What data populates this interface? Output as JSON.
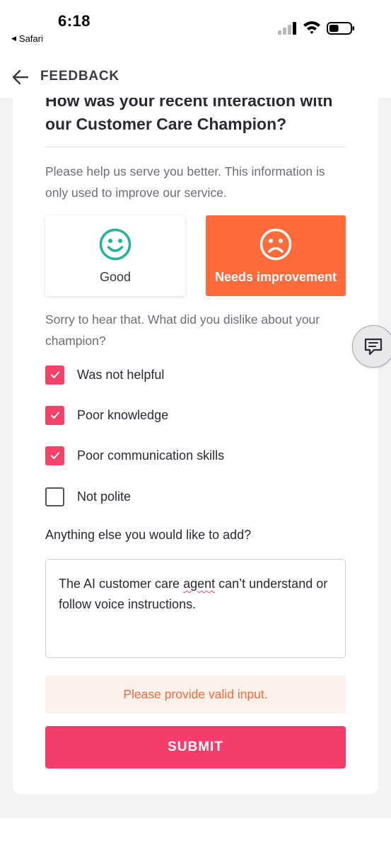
{
  "status_bar": {
    "time": "6:18",
    "back_app": "Safari",
    "battery_level": 0.45
  },
  "header": {
    "title": "FEEDBACK",
    "back_icon": "arrow-left-icon"
  },
  "feedback": {
    "question": "How was your recent interaction with our Customer Care Champion?",
    "help_text": "Please help us serve you better. This information is only used to improve our service.",
    "ratings": [
      {
        "label": "Good",
        "icon": "smiley-icon",
        "selected": false
      },
      {
        "label": "Needs improvement",
        "icon": "sad-face-icon",
        "selected": true
      }
    ],
    "dislike_prompt": "Sorry to hear that. What did you dislike about your champion?",
    "options": [
      {
        "label": "Was not helpful",
        "checked": true
      },
      {
        "label": "Poor knowledge",
        "checked": true
      },
      {
        "label": "Poor communication skills",
        "checked": true
      },
      {
        "label": "Not polite",
        "checked": false
      }
    ],
    "additional_label": "Anything else you would like to add?",
    "comment_before": "The AI customer care ",
    "comment_flagged_word": "agent",
    "comment_after": " can’t understand or follow voice instructions.",
    "error_message": "Please provide valid input.",
    "submit_label": "SUBMIT"
  },
  "colors": {
    "accent_pink": "#f53d6b",
    "checkbox_pink": "#f2436b",
    "needs_improvement_orange": "#ff6b3a",
    "good_green": "#1fb59a",
    "error_text": "#f26a3a",
    "error_bg": "#fdf1ec"
  },
  "chat_button_icon": "chat-feedback-icon"
}
